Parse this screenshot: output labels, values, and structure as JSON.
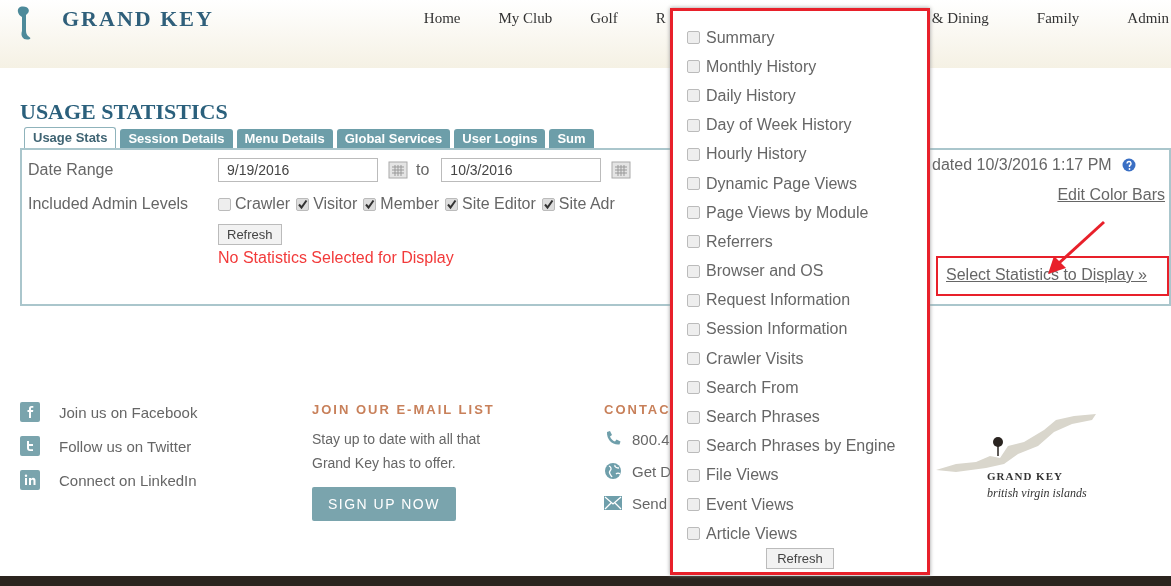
{
  "header": {
    "logo": "GRAND KEY",
    "nav_left": [
      "Home",
      "My Club",
      "Golf",
      "R"
    ],
    "nav_right": [
      "& Dining",
      "Family",
      "Admin"
    ]
  },
  "title": "USAGE STATISTICS",
  "tabs": [
    {
      "label": "Usage Stats",
      "selected": true
    },
    {
      "label": "Session Details",
      "selected": false
    },
    {
      "label": "Menu Details",
      "selected": false
    },
    {
      "label": "Global Services",
      "selected": false
    },
    {
      "label": "User Logins",
      "selected": false
    },
    {
      "label": "Sum",
      "selected": false
    }
  ],
  "date_range": {
    "label": "Date Range",
    "from": "9/19/2016",
    "to_label": "to",
    "to": "10/3/2016"
  },
  "admin_levels": {
    "label": "Included Admin Levels",
    "options": [
      {
        "label": "Crawler",
        "checked": false
      },
      {
        "label": "Visitor",
        "checked": true
      },
      {
        "label": "Member",
        "checked": true
      },
      {
        "label": "Site Editor",
        "checked": true
      },
      {
        "label": "Site Adr",
        "checked": true
      }
    ]
  },
  "refresh": "Refresh",
  "message": "No Statistics Selected for Display",
  "last_updated": "dated 10/3/2016 1:17 PM",
  "edit_color_bars": "Edit Color Bars",
  "select_statistics": "Select Statistics to Display »",
  "stats_menu": {
    "items": [
      {
        "label": "Summary",
        "checked": false
      },
      {
        "label": "Monthly History",
        "checked": false
      },
      {
        "label": "Daily History",
        "checked": false
      },
      {
        "label": "Day of Week History",
        "checked": false
      },
      {
        "label": "Hourly History",
        "checked": false
      },
      {
        "label": "Dynamic Page Views",
        "checked": false
      },
      {
        "label": "Page Views by Module",
        "checked": false
      },
      {
        "label": "Referrers",
        "checked": false
      },
      {
        "label": "Browser and OS",
        "checked": false
      },
      {
        "label": "Request Information",
        "checked": false
      },
      {
        "label": "Session Information",
        "checked": false
      },
      {
        "label": "Crawler Visits",
        "checked": false
      },
      {
        "label": "Search From",
        "checked": false
      },
      {
        "label": "Search Phrases",
        "checked": false
      },
      {
        "label": "Search Phrases by Engine",
        "checked": false
      },
      {
        "label": "File Views",
        "checked": false
      },
      {
        "label": "Event Views",
        "checked": false
      },
      {
        "label": "Article Views",
        "checked": false
      }
    ],
    "refresh": "Refresh"
  },
  "footer": {
    "social": [
      {
        "kind": "facebook",
        "label": "Join us on Facebook"
      },
      {
        "kind": "twitter",
        "label": "Follow us on Twitter"
      },
      {
        "kind": "linkedin",
        "label": "Connect on LinkedIn"
      }
    ],
    "email": {
      "heading": "JOIN OUR E-MAIL LIST",
      "text": "Stay up to date with all that Grand Key has to offer.",
      "button": "SIGN UP NOW"
    },
    "contact": {
      "heading": "CONTAC",
      "items": [
        {
          "kind": "phone",
          "text": "800.4"
        },
        {
          "kind": "globe",
          "text": "Get D"
        },
        {
          "kind": "mail",
          "text": "Send"
        }
      ]
    },
    "logo": {
      "name": "GRAND KEY",
      "place": "british virgin islands"
    }
  }
}
